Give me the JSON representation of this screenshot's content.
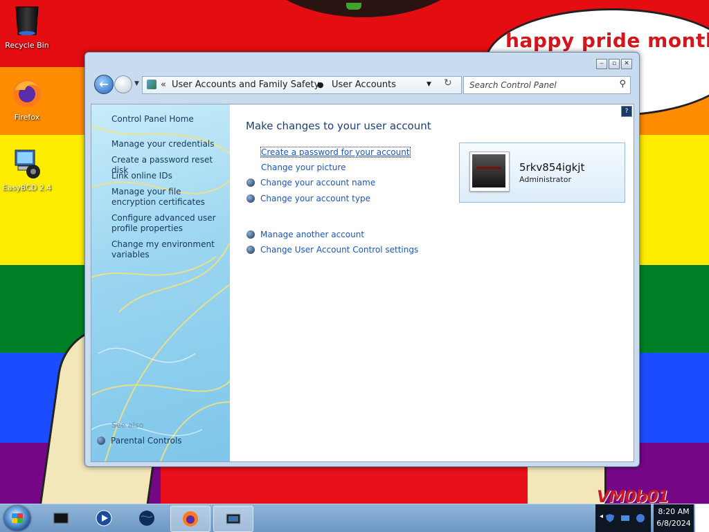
{
  "desktop": {
    "bubble_text": "happy pride month",
    "watermark": "VM0b01",
    "icons": [
      {
        "label": "Recycle Bin",
        "icon": "recycle-bin-icon"
      },
      {
        "label": "Firefox",
        "icon": "firefox-icon"
      },
      {
        "label": "EasyBCD 2.4",
        "icon": "easybcd-icon"
      }
    ]
  },
  "window": {
    "address": {
      "crumb1": "User Accounts and Family Safety",
      "crumb2": "User Accounts"
    },
    "search_placeholder": "Search Control Panel",
    "left_pane": {
      "home": "Control Panel Home",
      "links": [
        "Manage your credentials",
        "Create a password reset disk",
        "Link online IDs",
        "Manage your file encryption certificates",
        "Configure advanced user profile properties",
        "Change my environment variables"
      ],
      "see_also": "See also",
      "parental_controls": "Parental Controls"
    },
    "main": {
      "heading": "Make changes to your user account",
      "links": [
        "Create a password for your account",
        "Change your picture",
        "Change your account name",
        "Change your account type",
        "Manage another account",
        "Change User Account Control settings"
      ],
      "user": {
        "name": "5rkv854igkjt",
        "role": "Administrator"
      }
    }
  },
  "taskbar": {
    "time": "8:20 AM",
    "date": "6/8/2024"
  }
}
